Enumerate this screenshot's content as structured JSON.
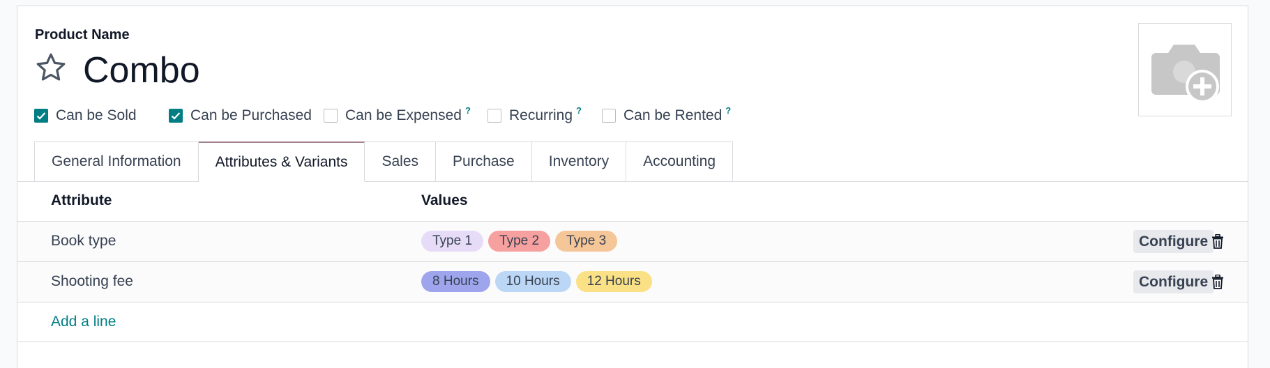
{
  "product": {
    "field_label": "Product Name",
    "name": "Combo"
  },
  "checkboxes": [
    {
      "label": "Can be Sold",
      "checked": true,
      "help": ""
    },
    {
      "label": "Can be Purchased",
      "checked": true,
      "help": ""
    },
    {
      "label": "Can be Expensed",
      "checked": false,
      "help": "?"
    },
    {
      "label": "Recurring",
      "checked": false,
      "help": "?"
    },
    {
      "label": "Can be Rented",
      "checked": false,
      "help": "?"
    }
  ],
  "tabs": [
    {
      "label": "General Information",
      "active": false
    },
    {
      "label": "Attributes & Variants",
      "active": true
    },
    {
      "label": "Sales",
      "active": false
    },
    {
      "label": "Purchase",
      "active": false
    },
    {
      "label": "Inventory",
      "active": false
    },
    {
      "label": "Accounting",
      "active": false
    }
  ],
  "table": {
    "headers": {
      "attribute": "Attribute",
      "values": "Values"
    },
    "rows": [
      {
        "attribute": "Book type",
        "values": [
          {
            "label": "Type 1",
            "color": "#e6dcf7"
          },
          {
            "label": "Type 2",
            "color": "#f6a09f"
          },
          {
            "label": "Type 3",
            "color": "#f5c697"
          }
        ],
        "configure_label": "Configure"
      },
      {
        "attribute": "Shooting fee",
        "values": [
          {
            "label": "8 Hours",
            "color": "#9ea5ec"
          },
          {
            "label": "10 Hours",
            "color": "#bcd7f5"
          },
          {
            "label": "12 Hours",
            "color": "#fbe185"
          }
        ],
        "configure_label": "Configure"
      }
    ],
    "add_line_label": "Add a line"
  },
  "icons": {
    "favorite": "star-outline-icon",
    "image": "camera-add-icon",
    "delete": "trash-icon",
    "check": "check-icon"
  },
  "colors": {
    "accent": "#017e84",
    "active_tab_border": "#a5828f"
  }
}
